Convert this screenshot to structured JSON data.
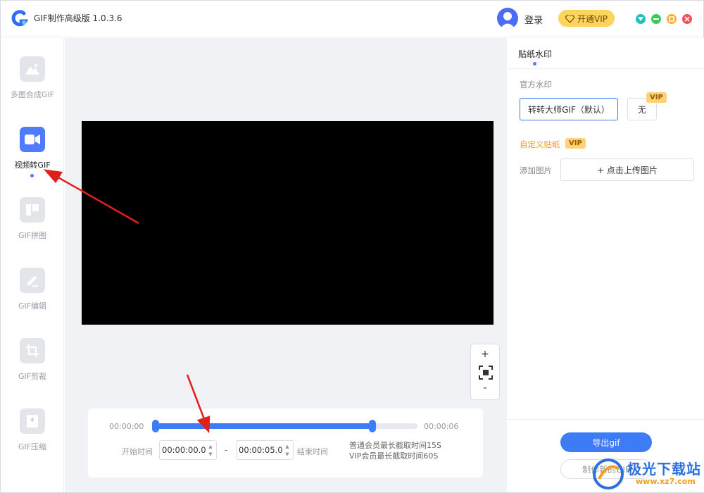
{
  "app": {
    "title": "GIF制作高级版 1.0.3.6",
    "login_label": "登录",
    "vip_button": "开通VIP"
  },
  "window_controls": {
    "menu_color": "#2bbdbe",
    "minimize_color": "#3cc85a",
    "maximize_color": "#f4b13a",
    "close_color": "#f4505a"
  },
  "sidebar": {
    "items": [
      {
        "label": "多图合成GIF",
        "icon": "mountain-image-icon",
        "active": false
      },
      {
        "label": "视频转GIF",
        "icon": "video-camera-icon",
        "active": true
      },
      {
        "label": "GIF拼图",
        "icon": "collage-icon",
        "active": false
      },
      {
        "label": "GIF编辑",
        "icon": "pencil-edit-icon",
        "active": false
      },
      {
        "label": "GIF剪裁",
        "icon": "crop-icon",
        "active": false
      },
      {
        "label": "GIF压缩",
        "icon": "compress-icon",
        "active": false
      }
    ]
  },
  "zoom": {
    "plus": "+",
    "minus": "-",
    "fit_icon": "fit-screen-icon"
  },
  "timeline": {
    "start_label": "00:00:00",
    "end_label": "00:00:06",
    "selection_start_fraction": 0.0,
    "selection_end_fraction": 0.83,
    "start_time_label": "开始时间",
    "start_time_value": "00:00:00.0",
    "separator": "-",
    "end_time_value": "00:00:05.0",
    "end_time_label": "结束时间",
    "limit_note_1": "普通会员最长截取时间15S",
    "limit_note_2": "VIP会员最长截取时间60S"
  },
  "right_panel": {
    "tab_label": "贴纸水印",
    "official_watermark_label": "官方水印",
    "watermark_default": "转转大师GIF（默认）",
    "watermark_none": "无",
    "vip_tag": "VIP",
    "custom_sticker_label": "自定义贴纸",
    "add_image_label": "添加图片",
    "upload_button": "+ 点击上传图片",
    "export_button": "导出gif",
    "new_gif_button": "制作新的GIF"
  },
  "site_watermark": {
    "title": "极光下载站",
    "url": "www.xz7.com"
  },
  "colors": {
    "accent": "#3d7bf7",
    "vip_yellow": "#ffd45a",
    "annotation_red": "#e0201a"
  }
}
